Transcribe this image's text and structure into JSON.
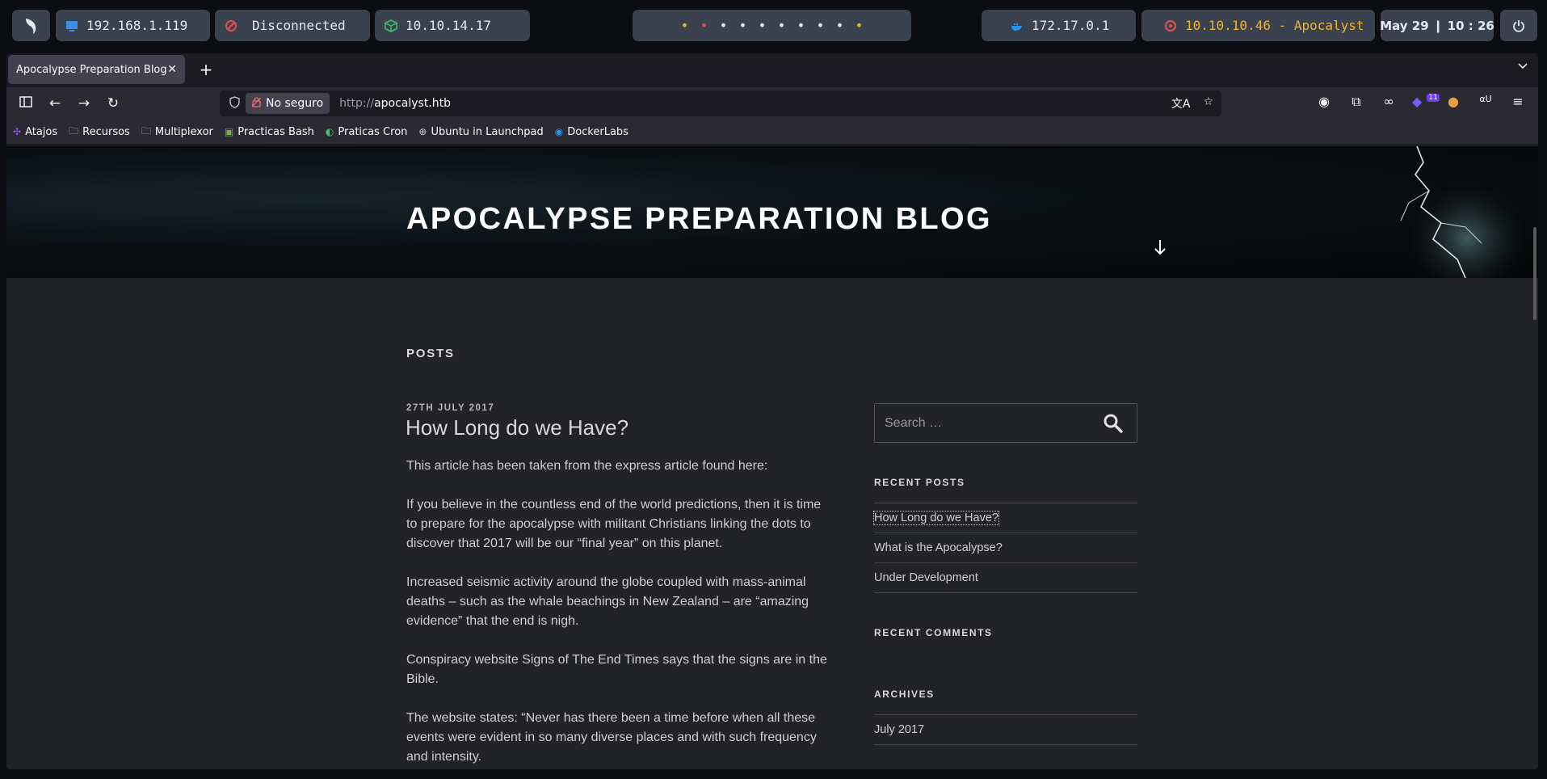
{
  "system_bar": {
    "host_ip": "192.168.1.119",
    "vpn_status": "Disconnected",
    "tun_ip": "10.10.14.17",
    "workspace_dots": [
      "•",
      "•",
      "•",
      "•",
      "•",
      "•",
      "•",
      "•",
      "•",
      "•"
    ],
    "workspace_colors": [
      "#f0b429",
      "#e05252",
      "#e6e9ee",
      "#e6e9ee",
      "#e6e9ee",
      "#e6e9ee",
      "#e6e9ee",
      "#e6e9ee",
      "#e6e9ee",
      "#f0b429"
    ],
    "docker_ip": "172.17.0.1",
    "target": "10.10.10.46 - Apocalyst",
    "clock": "May 29 ❙ 10 : 26"
  },
  "browser": {
    "tab_title": "Apocalypse Preparation Blog",
    "not_secure_label": "No seguro",
    "url_proto": "http://",
    "url_host": "apocalyst.htb",
    "extension_badge": "11",
    "bookmarks": [
      {
        "label": "Atajos",
        "icon": "puzzle-icon"
      },
      {
        "label": "Recursos",
        "icon": "folder-icon"
      },
      {
        "label": "Multiplexor",
        "icon": "folder-icon"
      },
      {
        "label": "Practicas Bash",
        "icon": "bash-icon"
      },
      {
        "label": "Praticas Cron",
        "icon": "cron-icon"
      },
      {
        "label": "Ubuntu in Launchpad",
        "icon": "globe-icon"
      },
      {
        "label": "DockerLabs",
        "icon": "docker-icon"
      }
    ]
  },
  "site": {
    "title": "Apocalypse Preparation Blog",
    "posts_heading": "POSTS",
    "post": {
      "date": "27TH JULY 2017",
      "title": "How Long do we Have?",
      "paragraphs": [
        "This article has been taken from the express article found here:",
        "If you believe in the countless end of the world predictions, then it is time to prepare for the apocalypse with militant Christians linking the dots to discover that 2017 will be our “final year” on this planet.",
        "Increased seismic activity around the globe coupled with mass-animal deaths – such as the whale beachings in New Zealand – are “amazing evidence” that the end is nigh.",
        "Conspiracy website Signs of The End Times says that the signs are in the Bible.",
        "The website states: “Never has there been a time before when all these events were evident in so many diverse places and with such frequency and intensity."
      ]
    },
    "sidebar": {
      "search_placeholder": "Search …",
      "recent_posts_title": "RECENT POSTS",
      "recent_posts": [
        "How Long do we Have?",
        "What is the Apocalypse?",
        "Under Development"
      ],
      "recent_comments_title": "RECENT COMMENTS",
      "archives_title": "ARCHIVES",
      "archives": [
        "July 2017"
      ]
    }
  }
}
